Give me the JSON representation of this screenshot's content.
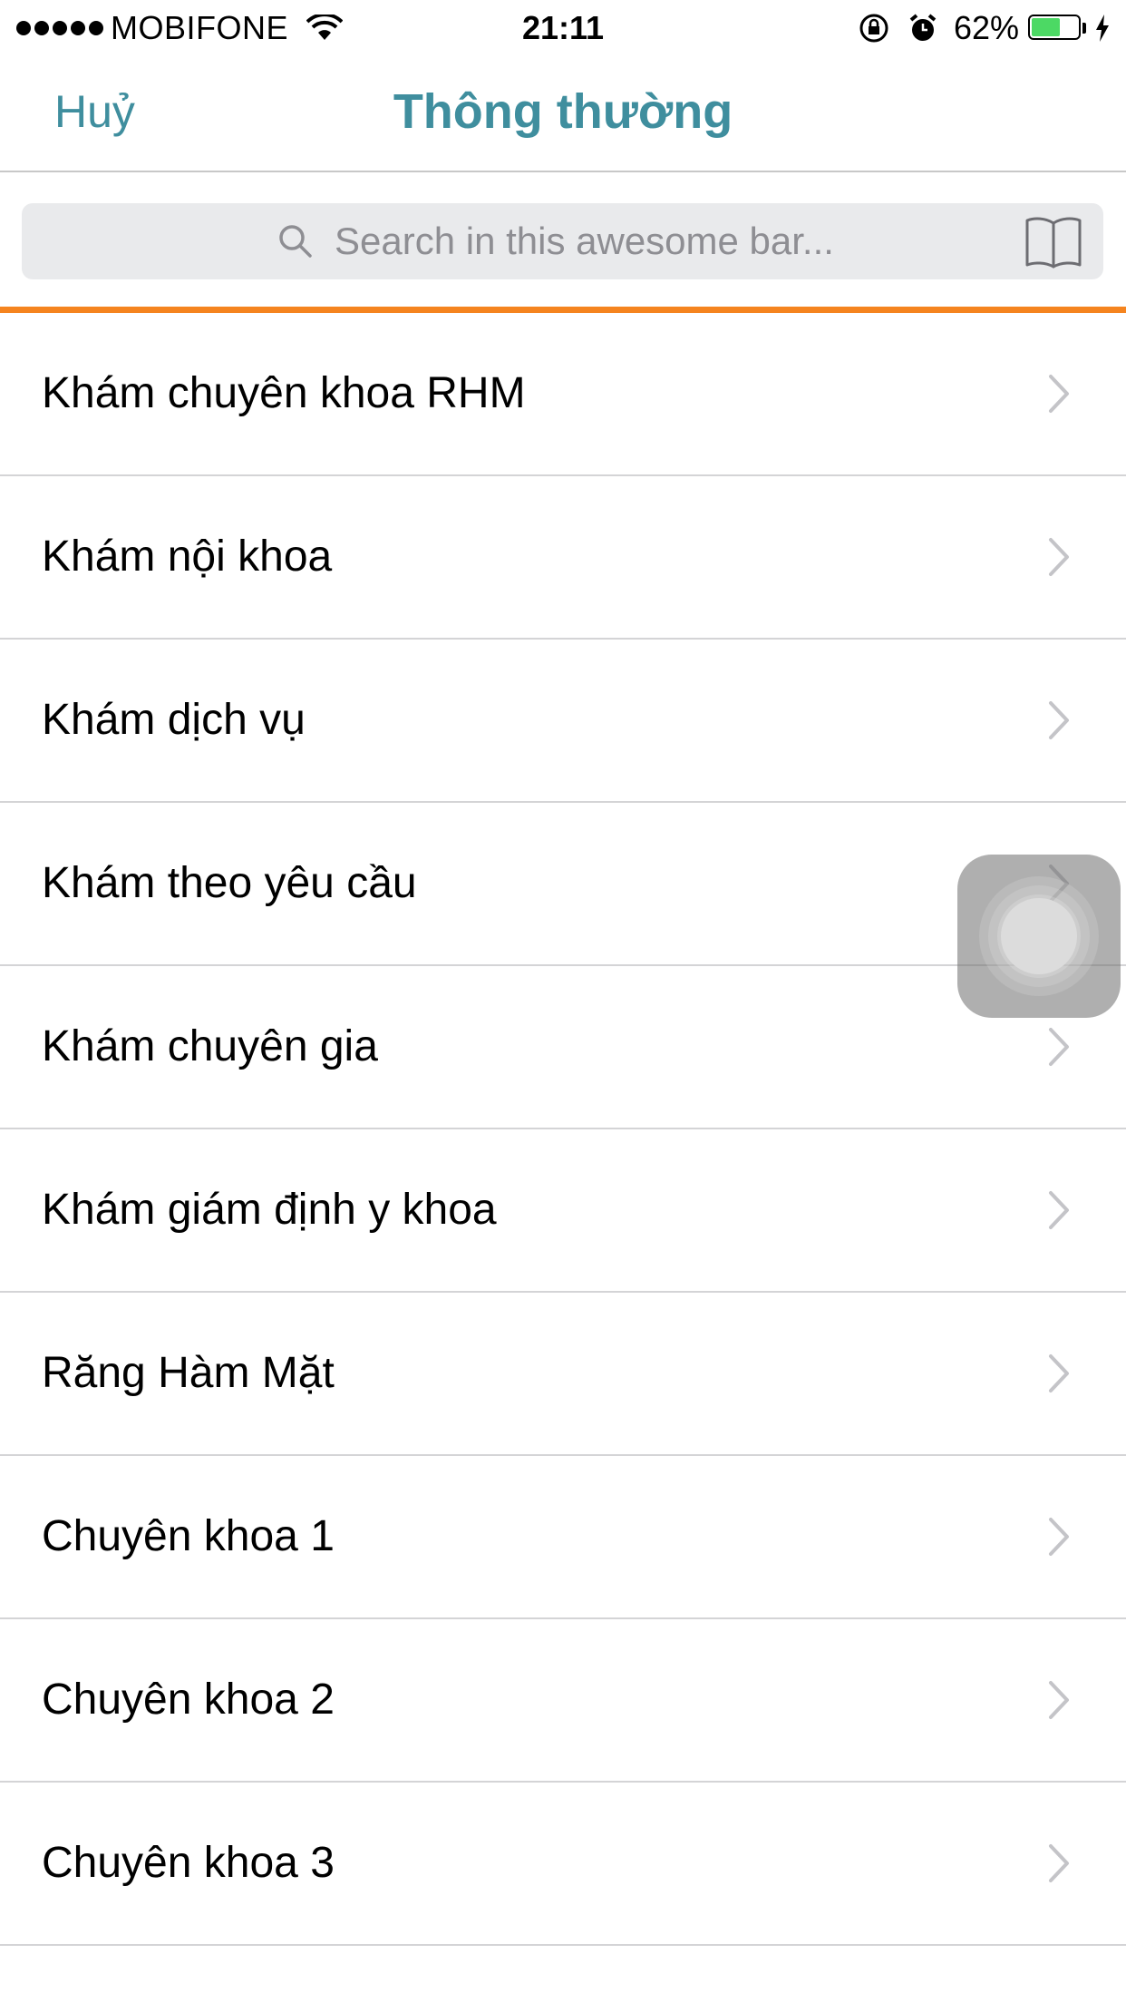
{
  "status_bar": {
    "carrier": "MOBIFONE",
    "time": "21:11",
    "battery_percent_label": "62%",
    "battery_level": 0.62,
    "icons": [
      "signal-dots-icon",
      "wifi-icon",
      "rotation-lock-icon",
      "alarm-icon",
      "battery-icon",
      "charging-bolt-icon"
    ]
  },
  "nav": {
    "cancel_label": "Huỷ",
    "title": "Thông thường"
  },
  "search": {
    "placeholder": "Search in this awesome bar...",
    "value": ""
  },
  "colors": {
    "accent": "#3f8e9e",
    "search_underline": "#f5841f",
    "search_bg": "#e9eaec",
    "battery_fill": "#4cd964"
  },
  "list": {
    "items": [
      {
        "label": "Khám chuyên khoa RHM"
      },
      {
        "label": "Khám nội khoa"
      },
      {
        "label": "Khám dịch vụ"
      },
      {
        "label": "Khám theo yêu cầu"
      },
      {
        "label": "Khám chuyên gia"
      },
      {
        "label": "Khám giám định y khoa"
      },
      {
        "label": "Răng Hàm Mặt"
      },
      {
        "label": "Chuyên khoa 1"
      },
      {
        "label": "Chuyên khoa 2"
      },
      {
        "label": "Chuyên khoa 3"
      }
    ]
  }
}
